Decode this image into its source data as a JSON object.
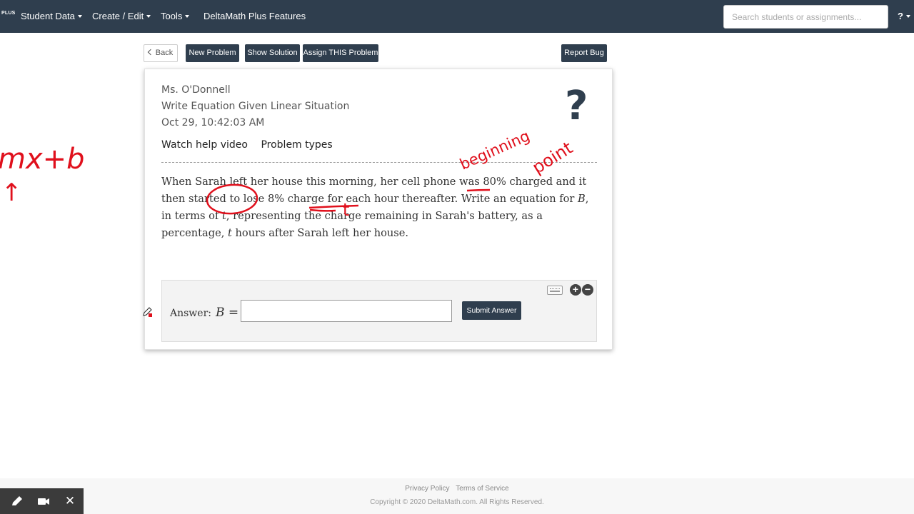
{
  "nav": {
    "brand_plus": "PLUS",
    "items": [
      {
        "label": "Student Data"
      },
      {
        "label": "Create / Edit"
      },
      {
        "label": "Tools"
      },
      {
        "label": "DeltaMath Plus Features"
      }
    ],
    "search_placeholder": "Search students or assignments...",
    "help_label": "?"
  },
  "toolbar": {
    "back_label": "Back",
    "new_problem_label": "New Problem",
    "show_solution_label": "Show Solution",
    "assign_label": "Assign THIS Problem",
    "report_bug_label": "Report Bug"
  },
  "problem_card": {
    "teacher": "Ms. O'Donnell",
    "skill_title": "Write Equation Given Linear Situation",
    "timestamp": "Oct 29, 10:42:03 AM",
    "help_icon": "?",
    "watch_help_video": "Watch help video",
    "problem_types": "Problem types",
    "question": {
      "p1": "When Sarah left her house this morning, her cell phone was 80% charged and it then started to lose 8% charge for each hour thereafter. Write an equation for ",
      "var_b": "B",
      "p2": ", in terms of ",
      "var_t1": "t",
      "p3": ", representing the charge remaining in Sarah's battery, as a percentage, ",
      "var_t2": "t",
      "p4": " hours after Sarah left her house."
    },
    "answer_label": "Answer:",
    "answer_var": "B =",
    "answer_value": "",
    "plus_symbol": "+",
    "minus_symbol": "−",
    "submit_label": "Submit Answer"
  },
  "footer": {
    "privacy": "Privacy Policy",
    "terms": "Terms of Service",
    "copyright": "Copyright © 2020 DeltaMath.com. All Rights Reserved."
  },
  "ink_annotations": {
    "formula": "mx+b",
    "arrow": "↑",
    "note_beginning": "beginning",
    "note_point": "point",
    "note_t": "t",
    "color": "#e0101c"
  },
  "colors": {
    "nav_bg": "#2f3e4e",
    "button_dark": "#2f3e4e",
    "ink_red": "#e0101c"
  },
  "recording_toolbar": {
    "icons": [
      "pen-icon",
      "camera-icon",
      "close-icon"
    ],
    "close_glyph": "✕"
  }
}
